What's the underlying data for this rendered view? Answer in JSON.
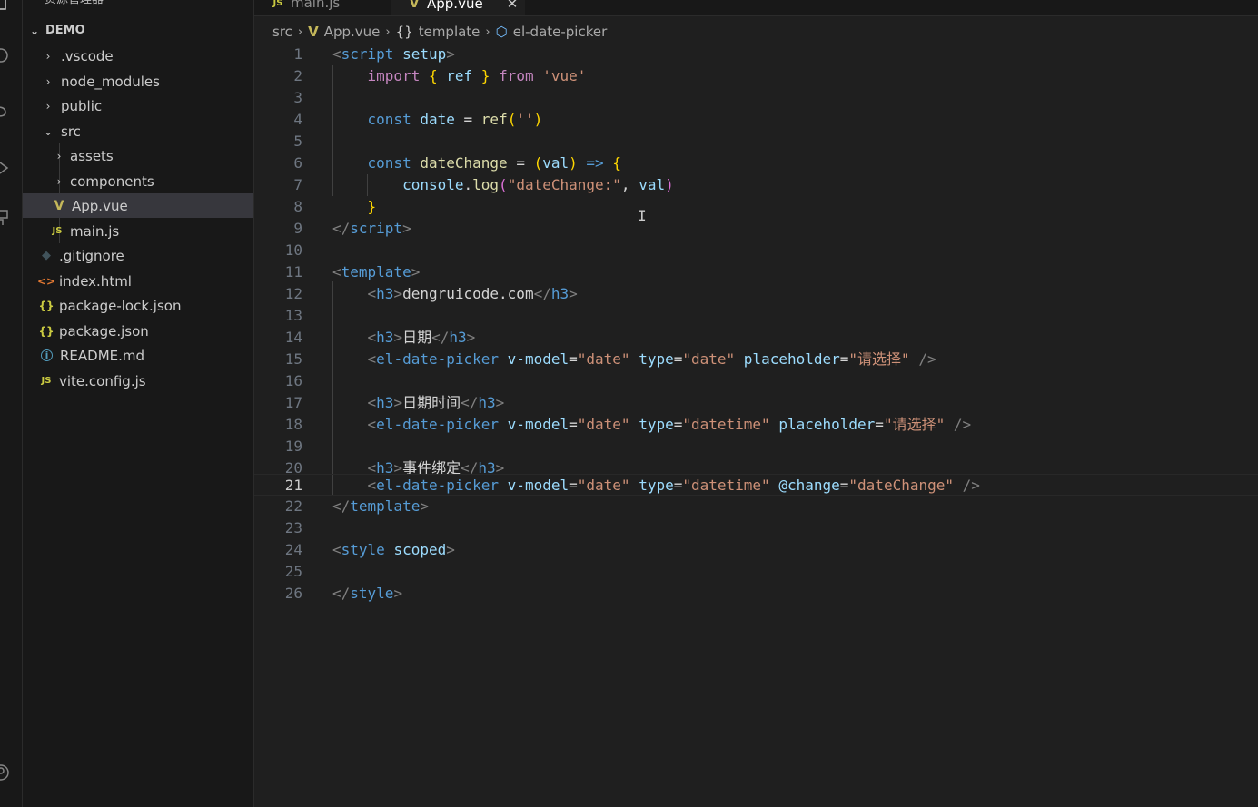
{
  "explorer": {
    "title": "资源管理器",
    "root": "DEMO",
    "items": [
      {
        "label": ".vscode",
        "icon": "chevron-right-icon"
      },
      {
        "label": "node_modules",
        "icon": "chevron-right-icon"
      },
      {
        "label": "public",
        "icon": "chevron-right-icon"
      },
      {
        "label": "src",
        "icon": "chevron-down-icon"
      },
      {
        "label": "assets",
        "icon": "chevron-right-icon"
      },
      {
        "label": "components",
        "icon": "chevron-right-icon"
      },
      {
        "label": "App.vue",
        "icon": "vue-file-icon"
      },
      {
        "label": "main.js",
        "icon": "js-file-icon"
      },
      {
        "label": ".gitignore",
        "icon": "git-file-icon"
      },
      {
        "label": "index.html",
        "icon": "html-file-icon"
      },
      {
        "label": "package-lock.json",
        "icon": "json-file-icon"
      },
      {
        "label": "package.json",
        "icon": "json-file-icon"
      },
      {
        "label": "README.md",
        "icon": "info-file-icon"
      },
      {
        "label": "vite.config.js",
        "icon": "js-file-icon"
      }
    ]
  },
  "tabs": [
    {
      "label": "main.js",
      "icon": "js-file-icon"
    },
    {
      "label": "App.vue",
      "icon": "vue-file-icon",
      "active": true
    }
  ],
  "breadcrumb": {
    "src": "src",
    "file": "App.vue",
    "section": "template",
    "element": "el-date-picker"
  },
  "editor": {
    "current_line": 21,
    "line_numbers": [
      "1",
      "2",
      "3",
      "4",
      "5",
      "6",
      "7",
      "8",
      "9",
      "10",
      "11",
      "12",
      "13",
      "14",
      "15",
      "16",
      "17",
      "18",
      "19",
      "20",
      "21",
      "22",
      "23",
      "24",
      "25",
      "26"
    ],
    "tokens": {
      "l1_open": "<",
      "l1_tag": "script",
      "l1_attr": "setup",
      "l1_close": ">",
      "l2_import": "import",
      "l2_ref": "ref",
      "l2_from": "from",
      "l2_str": "'vue'",
      "l4_const": "const",
      "l4_var": "date",
      "l4_fn": "ref",
      "l4_str": "''",
      "l6_const": "const",
      "l6_var": "dateChange",
      "l6_param": "val",
      "l6_arrow": "=>",
      "l7_obj": "console",
      "l7_fn": "log",
      "l7_str": "\"dateChange:\"",
      "l7_param": "val",
      "l9_tag": "script",
      "l11_tag": "template",
      "l12_tag": "h3",
      "l12_text": "dengruicode.com",
      "l14_tag": "h3",
      "l14_text": "日期",
      "l15_tag": "el-date-picker",
      "l15_a1": "v-model",
      "l15_v1": "\"date\"",
      "l15_a2": "type",
      "l15_v2": "\"date\"",
      "l15_a3": "placeholder",
      "l15_v3": "\"请选择\"",
      "l17_tag": "h3",
      "l17_text": "日期时间",
      "l18_tag": "el-date-picker",
      "l18_a1": "v-model",
      "l18_v1": "\"date\"",
      "l18_a2": "type",
      "l18_v2": "\"datetime\"",
      "l18_a3": "placeholder",
      "l18_v3": "\"请选择\"",
      "l20_tag": "h3",
      "l20_text": "事件绑定",
      "l21_tag": "el-date-picker",
      "l21_a1": "v-model",
      "l21_v1": "\"date\"",
      "l21_a2": "type",
      "l21_v2": "\"datetime\"",
      "l21_a3": "@change",
      "l21_v3": "\"dateChange\"",
      "l22_tag": "template",
      "l24_tag": "style",
      "l24_attr": "scoped",
      "l26_tag": "style"
    }
  },
  "colors": {
    "background": "#1f1f1f",
    "sidebar": "#181818",
    "selected_row": "#37373d",
    "tag": "#569cd6",
    "attribute": "#9cdcfe",
    "string": "#ce9178",
    "function": "#dcdcaa",
    "keyword_control": "#c586c0"
  }
}
